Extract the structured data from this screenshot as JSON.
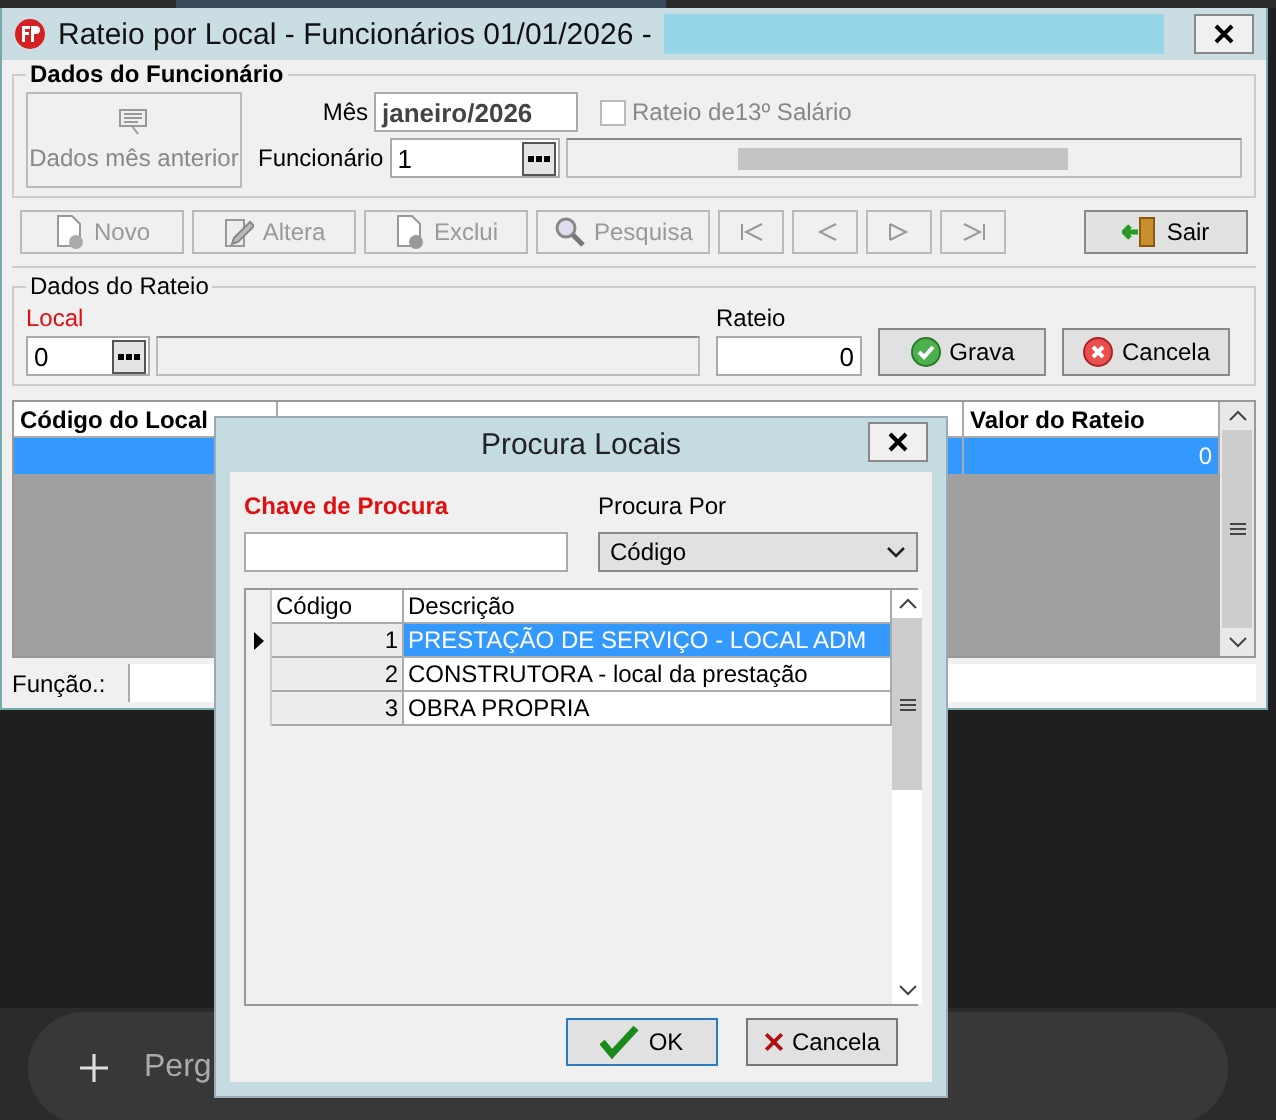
{
  "window": {
    "title": "Rateio por Local - Funcionários 01/01/2026 -"
  },
  "employee_group": {
    "legend": "Dados do Funcionário",
    "prev_button": {
      "label": "Dados mês anterior",
      "disabled": true
    },
    "month": {
      "label": "Mês",
      "value": "janeiro/2026"
    },
    "rateio_13": {
      "label": "Rateio de13º Salário",
      "checked": false,
      "disabled": true
    },
    "employee": {
      "label": "Funcionário",
      "value": "1"
    }
  },
  "toolbar": [
    {
      "kind": "new",
      "label": "Novo",
      "disabled": true
    },
    {
      "kind": "edit",
      "label": "Altera",
      "disabled": true
    },
    {
      "kind": "delete",
      "label": "Exclui",
      "disabled": true
    },
    {
      "kind": "search",
      "label": "Pesquisa",
      "disabled": true
    },
    {
      "kind": "first",
      "disabled": true
    },
    {
      "kind": "prev",
      "disabled": true
    },
    {
      "kind": "next",
      "disabled": true
    },
    {
      "kind": "last",
      "disabled": true
    },
    {
      "kind": "exit",
      "label": "Sair",
      "disabled": false
    }
  ],
  "rateio_group": {
    "legend": "Dados do Rateio",
    "local": {
      "label": "Local",
      "value": "0"
    },
    "rateio": {
      "label": "Rateio",
      "value": "0"
    },
    "buttons": [
      {
        "kind": "save",
        "label": "Grava"
      },
      {
        "kind": "cancel",
        "label": "Cancela"
      }
    ]
  },
  "grid": {
    "columns": [
      "Código do Local",
      "Valor do Rateio"
    ],
    "rows": [
      {
        "value": "0",
        "selected": true
      }
    ]
  },
  "status": {
    "label": "Função.:"
  },
  "prompt": {
    "placeholder": "Perg"
  },
  "dialog": {
    "title": "Procura Locais",
    "search_key": {
      "label": "Chave de Procura"
    },
    "search_by": {
      "label": "Procura Por",
      "value": "Código"
    },
    "columns": [
      "Código",
      "Descrição"
    ],
    "rows": [
      {
        "code": "1",
        "description": "PRESTAÇÃO DE SERVIÇO - LOCAL ADM",
        "selected": true
      },
      {
        "code": "2",
        "description": "CONSTRUTORA - local da prestação",
        "selected": false
      },
      {
        "code": "3",
        "description": "OBRA PROPRIA",
        "selected": false
      }
    ],
    "buttons": [
      {
        "kind": "ok",
        "label": "OK"
      },
      {
        "kind": "cancel",
        "label": "Cancela"
      }
    ]
  }
}
